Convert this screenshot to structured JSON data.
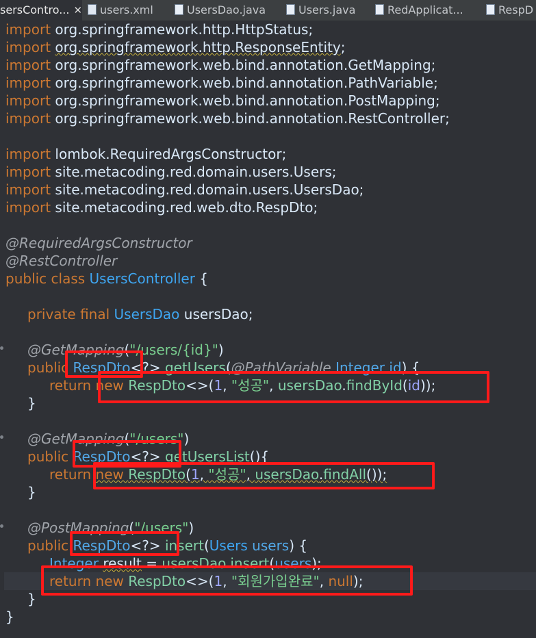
{
  "tabs": [
    {
      "label": "sersContro...",
      "active": true,
      "closable": true
    },
    {
      "label": "users.xml",
      "icon": "xml-file-icon"
    },
    {
      "label": "UsersDao.java",
      "icon": "java-file-icon"
    },
    {
      "label": "Users.java",
      "icon": "java-file-icon"
    },
    {
      "label": "RedApplicat...",
      "icon": "java-file-icon"
    },
    {
      "label": "RespD",
      "icon": "java-file-icon"
    }
  ],
  "code": {
    "l1_kw": "import",
    "l1_rest": " org.springframework.http.HttpStatus;",
    "l2_kw": "import",
    "l2_rest": "org.springframework.http.ResponseEntity",
    "l3_kw": "import",
    "l3_rest": " org.springframework.web.bind.annotation.GetMapping;",
    "l4_kw": "import",
    "l4_rest": " org.springframework.web.bind.annotation.PathVariable;",
    "l5_kw": "import",
    "l5_rest": " org.springframework.web.bind.annotation.PostMapping;",
    "l6_kw": "import",
    "l6_rest": " org.springframework.web.bind.annotation.RestController;",
    "l8_kw": "import",
    "l8_rest": " lombok.RequiredArgsConstructor;",
    "l9_kw": "import",
    "l9_rest": " site.metacoding.red.domain.users.Users;",
    "l10_kw": "import",
    "l10_rest": " site.metacoding.red.domain.users.UsersDao;",
    "l11_kw": "import",
    "l11_rest": " site.metacoding.red.web.dto.RespDto;",
    "ann1": "@RequiredArgsConstructor",
    "ann2": "@RestController",
    "class_kw": "public class ",
    "class_name": "UsersController",
    "brace_open": " {",
    "field_kw": "private final ",
    "field_type": "UsersDao",
    "field_name": " usersDao;",
    "get1_ann": "@GetMapping",
    "get1_open": "(",
    "get1_path": "\"/users/{id}\"",
    "get1_close": ")",
    "m1_public": "public ",
    "m1_type": "RespDto",
    "m1_generic": "<?> ",
    "m1_name": "getUsers",
    "m1_param_open": "(",
    "m1_param_ann": "@PathVariable",
    "m1_param_type": " Integer",
    "m1_param_name": " id",
    "m1_sig_end": ") {",
    "r1_return": "return ",
    "r1_new": "new ",
    "r1_cls": "RespDto",
    "r1_diamond": "<>(",
    "r1_num": "1",
    "r1_comma": ", ",
    "r1_str": "\"성공\"",
    "r1_comma2": ", ",
    "r1_obj": "usersDao",
    "r1_dot": ".",
    "r1_call": "findById",
    "r1_paren": "(",
    "r1_arg": "id",
    "r1_end": "));",
    "close1": "}",
    "get2_ann": "@GetMapping",
    "get2_open": "(",
    "get2_path": "\"/users\"",
    "get2_close": ")",
    "m2_public": "public ",
    "m2_type": "RespDto",
    "m2_generic": "<?> ",
    "m2_name": "getUsersList",
    "m2_sig_end": "(){",
    "r2_return": "return ",
    "r2_new": "new ",
    "r2_cls": "RespDto",
    "r2_paren": "(",
    "r2_num": "1",
    "r2_comma": ", ",
    "r2_str": "\"성공\"",
    "r2_comma2": ", ",
    "r2_obj": "usersDao",
    "r2_dot": ".",
    "r2_call": "findAll",
    "r2_end": "());",
    "close2": "}",
    "post_ann": "@PostMapping",
    "post_open": "(",
    "post_path": "\"/users\"",
    "post_close": ")",
    "m3_public": "public ",
    "m3_type": "RespDto",
    "m3_generic": "<?> ",
    "m3_name": "insert",
    "m3_paren": "(",
    "m3_ptype": "Users",
    "m3_pname": " users",
    "m3_sig_end": ") {",
    "i_type": "Integer ",
    "i_var": "result",
    "i_eq": " = ",
    "i_obj": "usersDao",
    "i_dot": ".",
    "i_call": "insert",
    "i_paren": "(",
    "i_arg": "users",
    "i_end": ");",
    "r3_return": "return ",
    "r3_new": "new ",
    "r3_cls": "RespDto",
    "r3_diamond": "<>(",
    "r3_num": "1",
    "r3_comma": ", ",
    "r3_str": "\"회원가입완료\"",
    "r3_comma2": ", ",
    "r3_null": "null",
    "r3_end": ");",
    "close3": "}",
    "close_class": "}"
  },
  "colors": {
    "background": "#2f3136",
    "keyword": "#cc7832",
    "string": "#79ce8f",
    "type": "#52a8e8",
    "annotation": "#a0a4aa",
    "highlight_box": "#ff1a1a"
  }
}
